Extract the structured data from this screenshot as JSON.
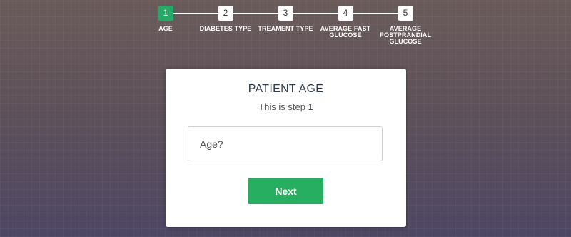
{
  "stepper": {
    "steps": [
      {
        "number": "1",
        "label": "AGE",
        "active": true
      },
      {
        "number": "2",
        "label": "DIABETES TYPE",
        "active": false
      },
      {
        "number": "3",
        "label": "TREAMENT TYPE",
        "active": false
      },
      {
        "number": "4",
        "label": "AVERAGE FAST GLUCOSE",
        "active": false
      },
      {
        "number": "5",
        "label": "AVERAGE POSTPRANDIAL GLUCOSE",
        "active": false
      }
    ]
  },
  "form": {
    "title": "PATIENT AGE",
    "subtitle": "This is step 1",
    "age_placeholder": "Age?",
    "age_value": "",
    "next_label": "Next"
  },
  "colors": {
    "accent": "#27ae60",
    "active_step": "#27a866",
    "text_dark": "#2c3e50"
  }
}
